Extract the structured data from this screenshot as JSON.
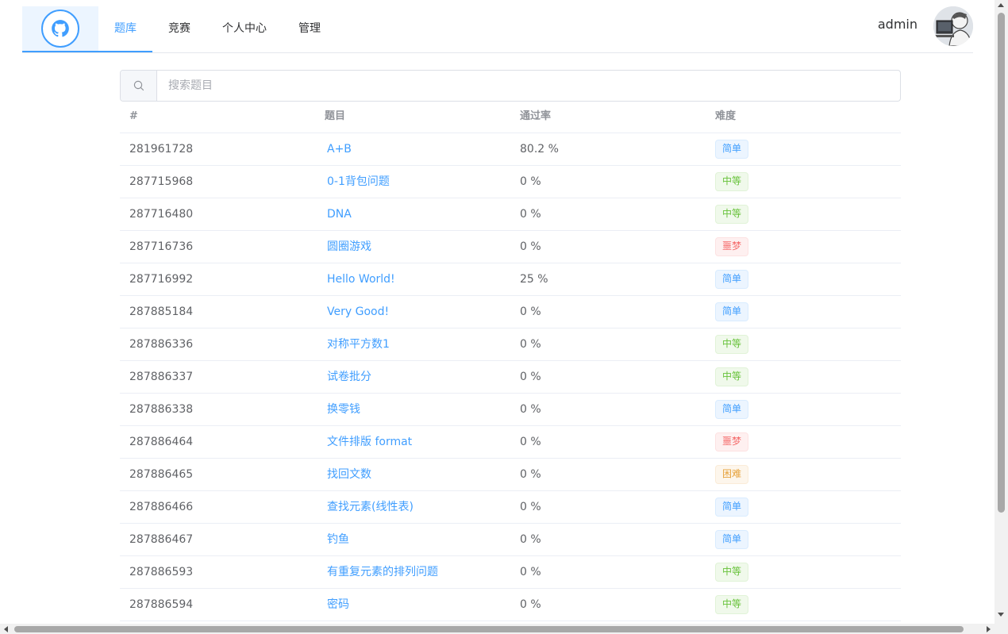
{
  "nav": {
    "items": [
      {
        "label": "题库",
        "active": true
      },
      {
        "label": "竞赛",
        "active": false
      },
      {
        "label": "个人中心",
        "active": false
      },
      {
        "label": "管理",
        "active": false
      }
    ],
    "logo_icon": "github-cat-icon",
    "username": "admin",
    "avatar_icon": "user-avatar-icon"
  },
  "search": {
    "icon": "search-icon",
    "placeholder": "搜索题目",
    "value": ""
  },
  "table": {
    "headers": [
      "#",
      "题目",
      "通过率",
      "难度"
    ],
    "rows": [
      {
        "id": "281961728",
        "title": "A+B",
        "rate": "80.2 %",
        "difficulty": "简单"
      },
      {
        "id": "287715968",
        "title": "0-1背包问题",
        "rate": "0 %",
        "difficulty": "中等"
      },
      {
        "id": "287716480",
        "title": "DNA",
        "rate": "0 %",
        "difficulty": "中等"
      },
      {
        "id": "287716736",
        "title": "圆圈游戏",
        "rate": "0 %",
        "difficulty": "噩梦"
      },
      {
        "id": "287716992",
        "title": "Hello World!",
        "rate": "25 %",
        "difficulty": "简单"
      },
      {
        "id": "287885184",
        "title": "Very Good!",
        "rate": "0 %",
        "difficulty": "简单"
      },
      {
        "id": "287886336",
        "title": "对称平方数1",
        "rate": "0 %",
        "difficulty": "中等"
      },
      {
        "id": "287886337",
        "title": "试卷批分",
        "rate": "0 %",
        "difficulty": "中等"
      },
      {
        "id": "287886338",
        "title": "换零钱",
        "rate": "0 %",
        "difficulty": "简单"
      },
      {
        "id": "287886464",
        "title": "文件排版 format",
        "rate": "0 %",
        "difficulty": "噩梦"
      },
      {
        "id": "287886465",
        "title": "找回文数",
        "rate": "0 %",
        "difficulty": "困难"
      },
      {
        "id": "287886466",
        "title": "查找元素(线性表)",
        "rate": "0 %",
        "difficulty": "简单"
      },
      {
        "id": "287886467",
        "title": "钓鱼",
        "rate": "0 %",
        "difficulty": "简单"
      },
      {
        "id": "287886593",
        "title": "有重复元素的排列问题",
        "rate": "0 %",
        "difficulty": "中等"
      },
      {
        "id": "287886594",
        "title": "密码",
        "rate": "0 %",
        "difficulty": "中等"
      }
    ]
  },
  "difficulty_colors": {
    "简单": {
      "text": "#409eff",
      "bg": "#ecf5ff",
      "border": "#d9ecff"
    },
    "中等": {
      "text": "#67c23a",
      "bg": "#f0f9eb",
      "border": "#e1f3d8"
    },
    "困难": {
      "text": "#e6a23c",
      "bg": "#fdf6ec",
      "border": "#faecd8"
    },
    "噩梦": {
      "text": "#f56c6c",
      "bg": "#fef0f0",
      "border": "#fde2e2"
    }
  }
}
